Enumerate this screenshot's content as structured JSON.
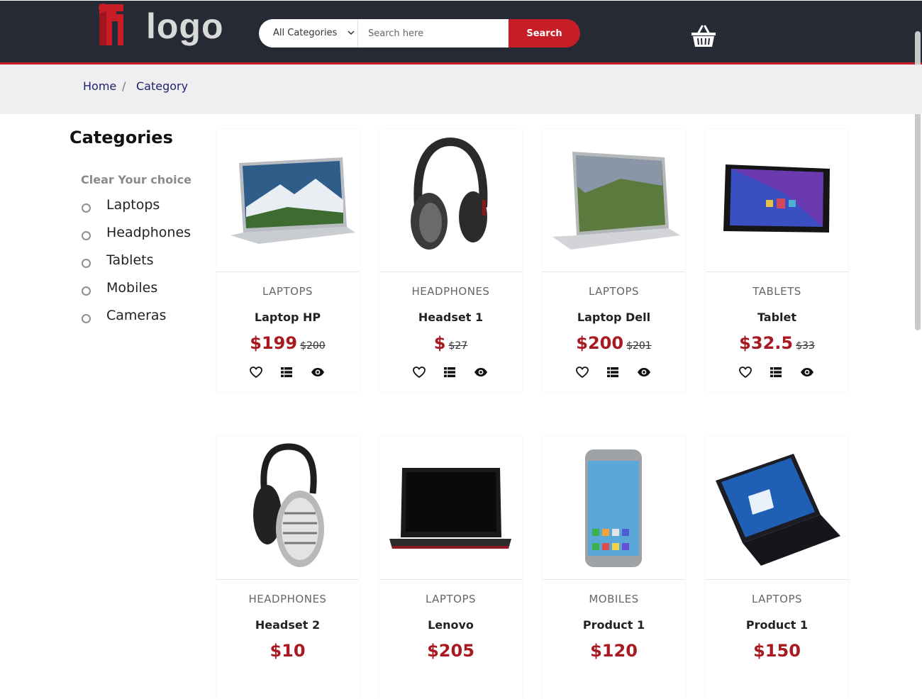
{
  "header": {
    "logo_text": "logo",
    "category_select": "All Categories",
    "search_placeholder": "Search here",
    "search_button": "Search"
  },
  "breadcrumb": {
    "home": "Home",
    "separator": "/",
    "current": "Category"
  },
  "sidebar": {
    "title": "Categories",
    "clear": "Clear Your choice",
    "items": [
      "Laptops",
      "Headphones",
      "Tablets",
      "Mobiles",
      "Cameras"
    ]
  },
  "products": [
    {
      "type": "LAPTOPS",
      "name": "Laptop HP",
      "price": "$199",
      "old_price": "$200",
      "image": "laptop-hp"
    },
    {
      "type": "HEADPHONES",
      "name": "Headset 1",
      "price": "$",
      "old_price": "$27",
      "image": "headset-1"
    },
    {
      "type": "LAPTOPS",
      "name": "Laptop Dell",
      "price": "$200",
      "old_price": "$201",
      "image": "laptop-dell"
    },
    {
      "type": "TABLETS",
      "name": "Tablet",
      "price": "$32.5",
      "old_price": "$33",
      "image": "tablet"
    },
    {
      "type": "HEADPHONES",
      "name": "Headset 2",
      "price": "$10",
      "old_price": "",
      "image": "headset-2"
    },
    {
      "type": "LAPTOPS",
      "name": "Lenovo",
      "price": "$205",
      "old_price": "",
      "image": "lenovo"
    },
    {
      "type": "MOBILES",
      "name": "Product 1",
      "price": "$120",
      "old_price": "",
      "image": "mobile"
    },
    {
      "type": "LAPTOPS",
      "name": "Product 1",
      "price": "$150",
      "old_price": "",
      "image": "laptop-asus"
    }
  ],
  "colors": {
    "header_bg": "#262a35",
    "accent": "#c61d26",
    "price": "#a81921",
    "breadcrumb_bg": "#efeff1"
  },
  "icons": [
    "basket-icon",
    "heart-icon",
    "list-icon",
    "eye-icon",
    "chevron-down-icon"
  ]
}
